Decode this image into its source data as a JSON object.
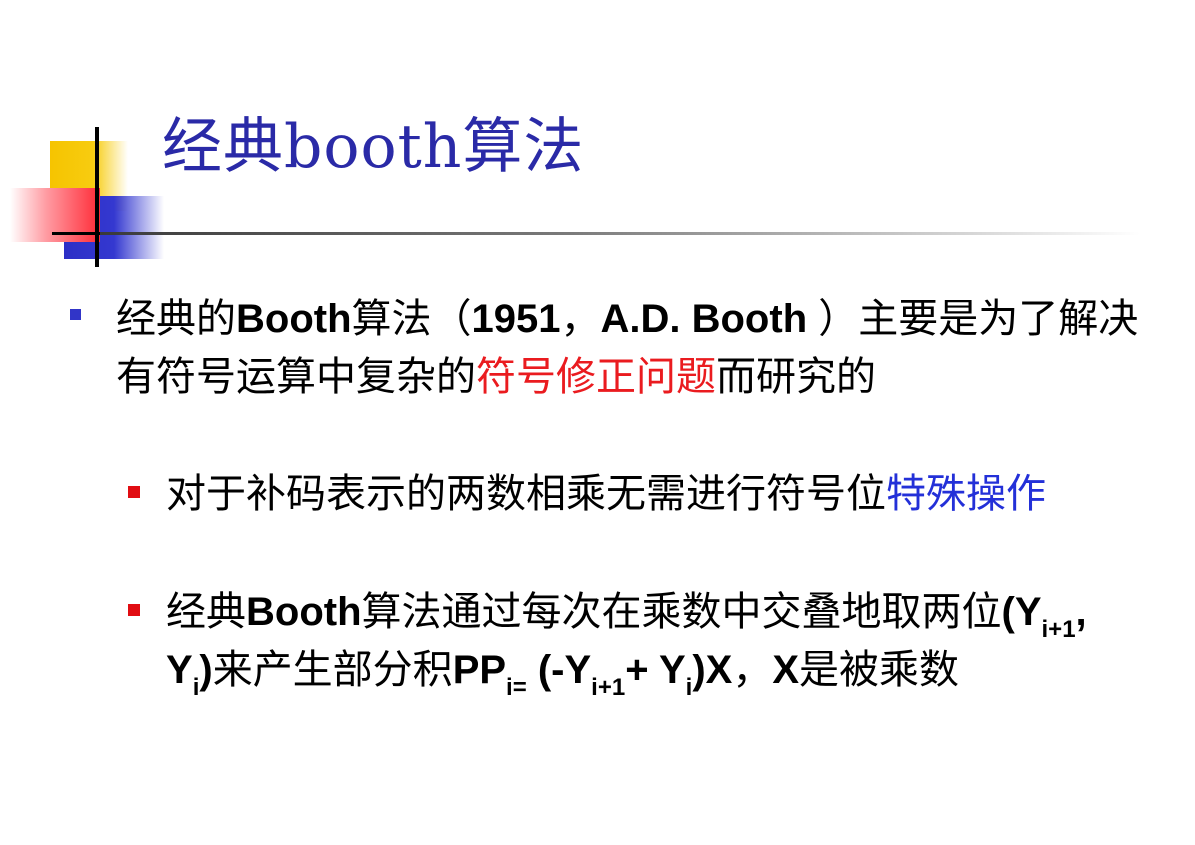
{
  "slide": {
    "title": "经典booth算法",
    "bullets": [
      {
        "parts": [
          {
            "text": "经典的",
            "style": "normal"
          },
          {
            "text": "Booth",
            "style": "en"
          },
          {
            "text": "算法（",
            "style": "normal"
          },
          {
            "text": "1951",
            "style": "en"
          },
          {
            "text": "，",
            "style": "normal"
          },
          {
            "text": "A.D. Booth ",
            "style": "en"
          },
          {
            "text": "）主要是为了解决有符号运算中复杂的",
            "style": "normal"
          },
          {
            "text": "符号修正问题",
            "style": "red"
          },
          {
            "text": "而研究的",
            "style": "normal"
          }
        ]
      },
      {
        "parts": [
          {
            "text": "对于补码表示的两数相乘无需进行符号位",
            "style": "normal"
          },
          {
            "text": "特殊操作",
            "style": "blue"
          }
        ]
      },
      {
        "parts": [
          {
            "text": "经典",
            "style": "normal"
          },
          {
            "text": "Booth",
            "style": "en"
          },
          {
            "text": "算法通过每次在乘数中交叠地取两位",
            "style": "normal"
          },
          {
            "text": "(Y",
            "style": "en"
          },
          {
            "text": "i+1",
            "style": "sub"
          },
          {
            "text": ", Y",
            "style": "en"
          },
          {
            "text": "i",
            "style": "sub"
          },
          {
            "text": ")",
            "style": "en"
          },
          {
            "text": "来产生部分积",
            "style": "normal"
          },
          {
            "text": "PP",
            "style": "en"
          },
          {
            "text": "i=",
            "style": "sub"
          },
          {
            "text": " (-Y",
            "style": "en"
          },
          {
            "text": "i+1",
            "style": "sub"
          },
          {
            "text": "+ Y",
            "style": "en"
          },
          {
            "text": "i",
            "style": "sub"
          },
          {
            "text": ")X",
            "style": "en"
          },
          {
            "text": "，",
            "style": "normal"
          },
          {
            "text": "X",
            "style": "en"
          },
          {
            "text": "是被乘数",
            "style": "normal"
          }
        ]
      }
    ]
  }
}
